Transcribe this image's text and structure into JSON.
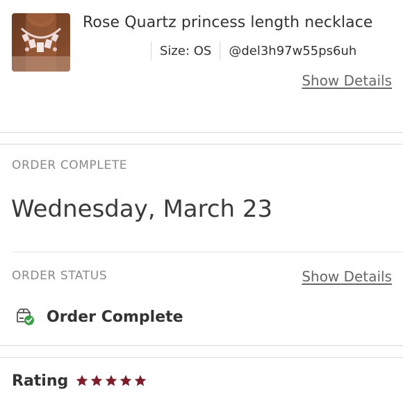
{
  "product": {
    "title": "Rose Quartz princess length necklace",
    "size": "Size: OS",
    "seller": "@del3h97w55ps6uh",
    "show_details_label": "Show Details",
    "thumbnail_icon": "necklace-photo"
  },
  "order": {
    "complete_label": "ORDER COMPLETE",
    "date": "Wednesday, March 23",
    "status_label": "ORDER STATUS",
    "show_details_label": "Show Details",
    "status_text": "Order Complete",
    "status_icon": "package-check-icon"
  },
  "rating": {
    "label": "Rating",
    "stars": 5,
    "max_stars": 5,
    "star_color": "#7d1f2b"
  },
  "colors": {
    "link": "#666666",
    "section_label": "#8a8a8a",
    "status_check": "#3aa14a"
  }
}
